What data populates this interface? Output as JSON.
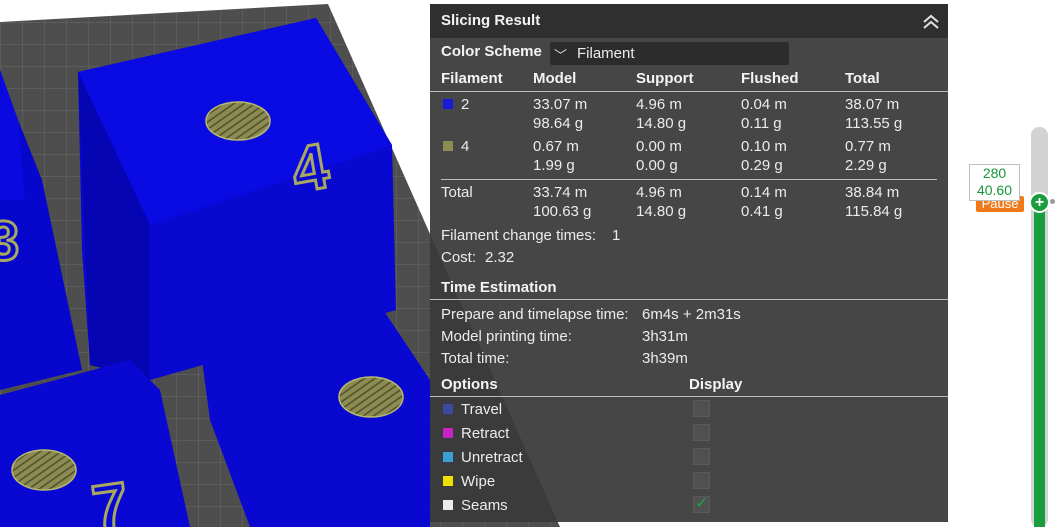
{
  "panel": {
    "title": "Slicing Result",
    "color_scheme": {
      "label": "Color Scheme",
      "value": "Filament"
    },
    "filament_table": {
      "headers": [
        "Filament",
        "Model",
        "Support",
        "Flushed",
        "Total"
      ],
      "rows": [
        {
          "name": "2",
          "color": "#1a1ad6",
          "model": [
            "33.07 m",
            "98.64 g"
          ],
          "support": [
            "4.96 m",
            "14.80 g"
          ],
          "flushed": [
            "0.04 m",
            "0.11 g"
          ],
          "total": [
            "38.07 m",
            "113.55 g"
          ]
        },
        {
          "name": "4",
          "color": "#8c8c52",
          "model": [
            "0.67 m",
            "1.99 g"
          ],
          "support": [
            "0.00 m",
            "0.00 g"
          ],
          "flushed": [
            "0.10 m",
            "0.29 g"
          ],
          "total": [
            "0.77 m",
            "2.29 g"
          ]
        }
      ],
      "total_row": {
        "name": "Total",
        "model": [
          "33.74 m",
          "100.63 g"
        ],
        "support": [
          "4.96 m",
          "14.80 g"
        ],
        "flushed": [
          "0.14 m",
          "0.41 g"
        ],
        "total": [
          "38.84 m",
          "115.84 g"
        ]
      }
    },
    "filament_change": {
      "label": "Filament change times:",
      "value": "1"
    },
    "cost": {
      "label": "Cost:",
      "value": "2.32"
    },
    "time_estimation": {
      "title": "Time Estimation",
      "rows": [
        {
          "label": "Prepare and timelapse time:",
          "value": "6m4s + 2m31s"
        },
        {
          "label": "Model printing time:",
          "value": "3h31m"
        },
        {
          "label": "Total time:",
          "value": "3h39m"
        }
      ]
    },
    "options": {
      "header_options": "Options",
      "header_display": "Display",
      "items": [
        {
          "label": "Travel",
          "color": "#3a4aa0",
          "checked": false
        },
        {
          "label": "Retract",
          "color": "#c424c4",
          "checked": false
        },
        {
          "label": "Unretract",
          "color": "#3aa0d6",
          "checked": false
        },
        {
          "label": "Wipe",
          "color": "#f0e000",
          "checked": false
        },
        {
          "label": "Seams",
          "color": "#ececec",
          "checked": true
        }
      ]
    }
  },
  "slider": {
    "layer": "280",
    "height": "40.60",
    "pause_label": "Pause"
  },
  "icons": {
    "collapse": "double-chevron-up-icon",
    "dropdown": "chevron-down-icon",
    "add": "plus-icon"
  },
  "colors": {
    "panel_bg": "#3a3a3a",
    "accent_green": "#1a9d3e",
    "model_blue": "#0a0adc",
    "pause_orange": "#f07a1a"
  }
}
